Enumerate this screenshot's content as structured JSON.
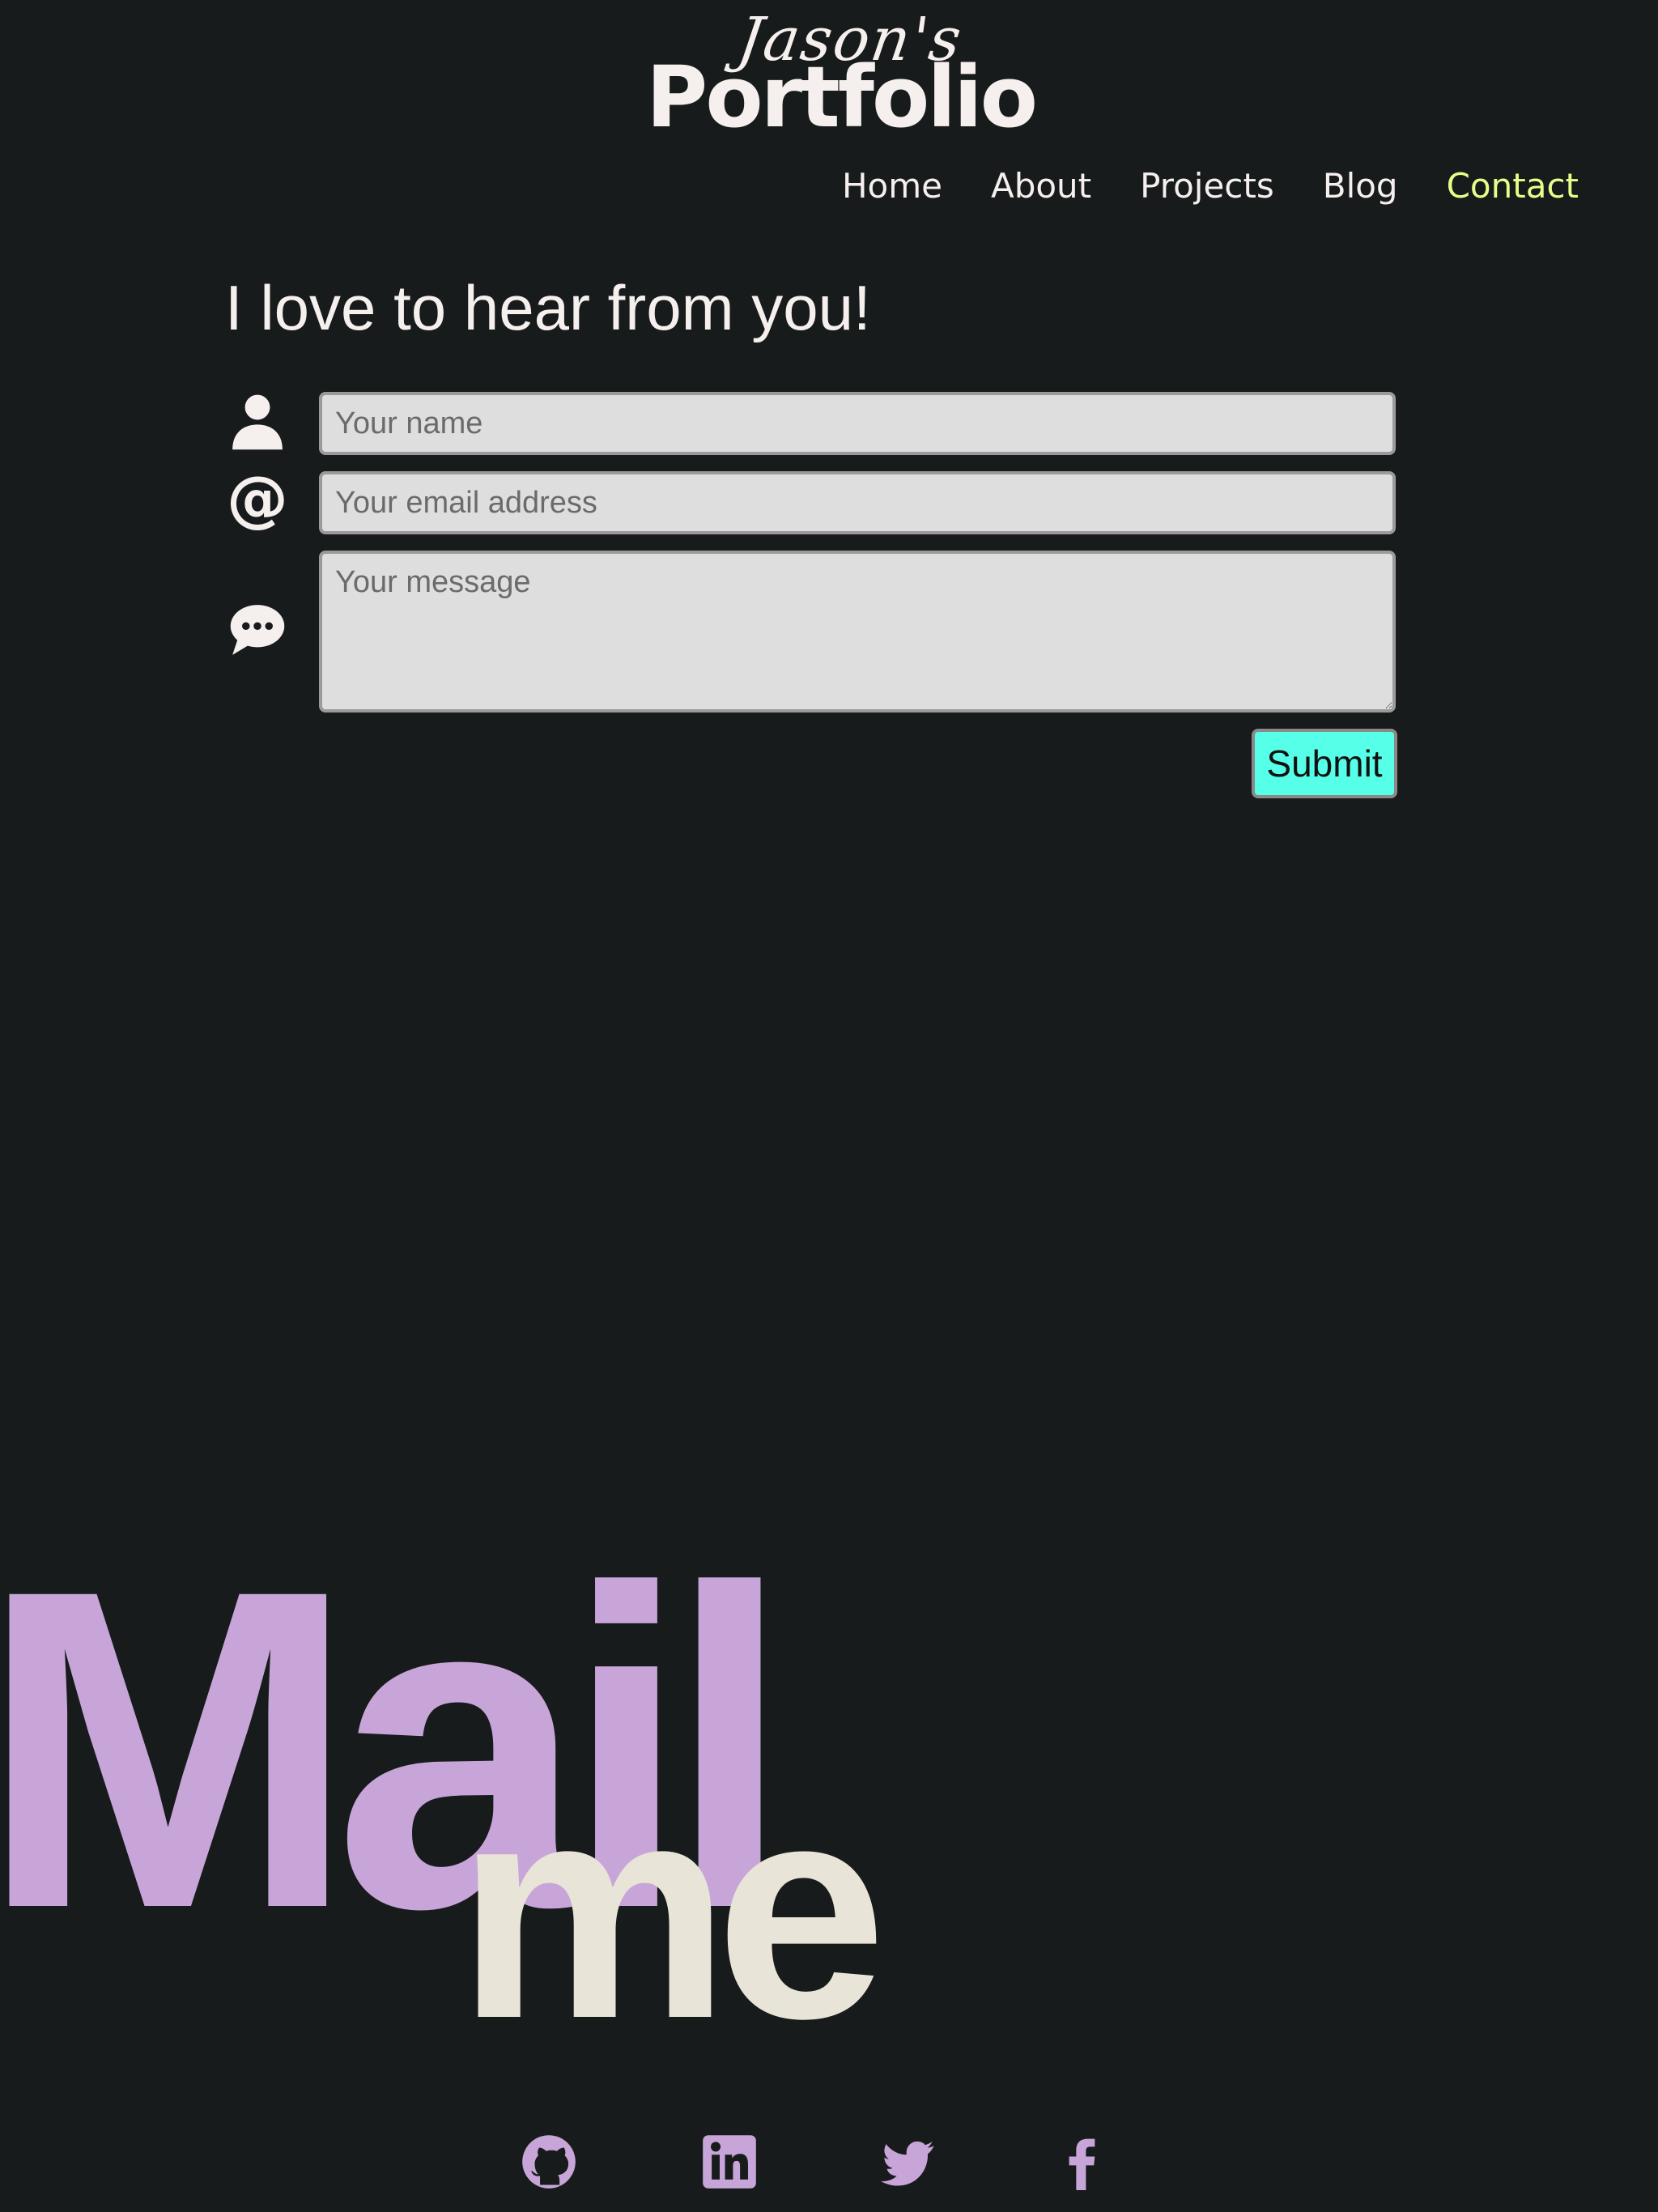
{
  "logo": {
    "script": "Jason's",
    "main": "Portfolio"
  },
  "nav": {
    "items": [
      {
        "label": "Home"
      },
      {
        "label": "About"
      },
      {
        "label": "Projects"
      },
      {
        "label": "Blog"
      },
      {
        "label": "Contact",
        "active": true
      }
    ],
    "active_color": "#e6ff8a"
  },
  "heading": "I love to hear from you!",
  "form": {
    "name_placeholder": "Your name",
    "email_placeholder": "Your email address",
    "message_placeholder": "Your message",
    "submit_label": "Submit",
    "submit_color": "#56ffe8",
    "icons": [
      "user-icon",
      "at-sign-icon",
      "chat-bubble-icon"
    ]
  },
  "decor": {
    "big_word": "Mail",
    "small_word": "me",
    "big_color": "#c8a5d8",
    "small_color": "#e8e4d8"
  },
  "social": {
    "icons": [
      "github-icon",
      "linkedin-icon",
      "twitter-icon",
      "facebook-icon"
    ],
    "color": "#c8a5d8"
  },
  "background": "#181b1b"
}
